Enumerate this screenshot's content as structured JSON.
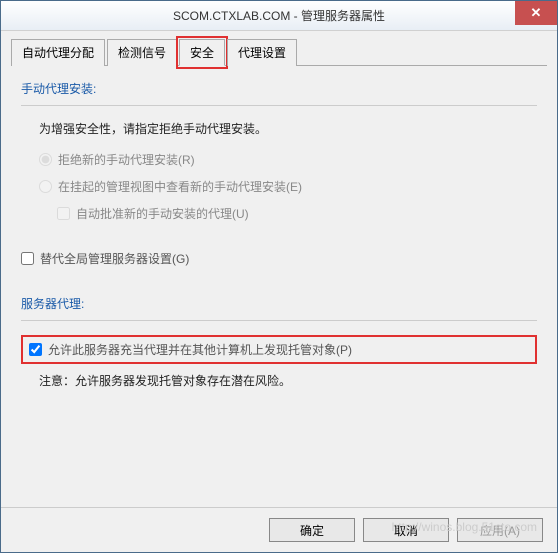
{
  "title": "SCOM.CTXLAB.COM - 管理服务器属性",
  "close": "✕",
  "tabs": {
    "auto_proxy": "自动代理分配",
    "heartbeat": "检测信号",
    "security": "安全",
    "proxy_settings": "代理设置"
  },
  "section": {
    "manual_install": "手动代理安装:",
    "manual_desc": "为增强安全性，请指定拒绝手动代理安装。",
    "reject_new": "拒绝新的手动代理安装(R)",
    "pending_view": "在挂起的管理视图中查看新的手动代理安装(E)",
    "auto_approve": "自动批准新的手动安装的代理(U)",
    "override_global": "替代全局管理服务器设置(G)",
    "server_proxy": "服务器代理:",
    "allow_proxy": "允许此服务器充当代理并在其他计算机上发现托管对象(P)",
    "note": "注意：允许服务器发现托管对象存在潜在风险。"
  },
  "buttons": {
    "ok": "确定",
    "cancel": "取消",
    "apply": "应用(A)"
  },
  "watermark": "http://winos.blog.51cto.com"
}
